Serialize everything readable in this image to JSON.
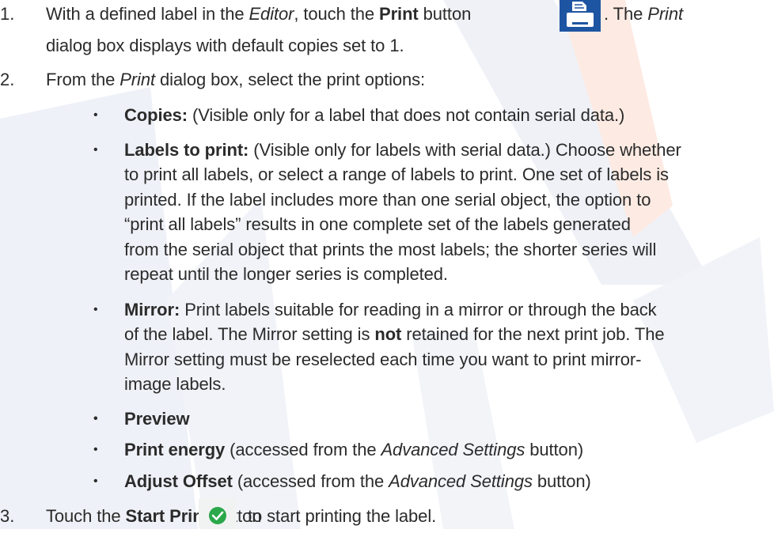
{
  "steps": [
    {
      "number": "1.",
      "lines": [
        {
          "t1": "With a defined label in the ",
          "i1": "Editor",
          "t2": ", touch the ",
          "b1": "Print",
          "t3": " button",
          "t4": ". The ",
          "i2": "Print"
        },
        {
          "t1": "dialog box displays with default copies set to 1."
        }
      ]
    },
    {
      "number": "2.",
      "lines": [
        {
          "t1": "From the ",
          "i1": "Print",
          "t2": " dialog box, select the print options:"
        }
      ]
    },
    {
      "number": "3.",
      "lines": [
        {
          "t1": "Touch the ",
          "b1": "Start Print",
          "t2": " button",
          "t3": " to start printing the label."
        }
      ]
    }
  ],
  "options": [
    {
      "bold": "Copies:",
      "lines": [
        " (Visible only for a label that does not contain serial data.)"
      ]
    },
    {
      "bold": "Labels to print:",
      "lines": [
        " (Visible only for labels with serial data.) Choose whether",
        "to print all labels, or select a range of labels to print. One set of labels is",
        "printed. If the label includes more than one serial object, the option to",
        "“print all labels” results in one complete set of the labels generated",
        "from the serial object that prints the most labels; the shorter series will",
        "repeat until the longer series is completed."
      ]
    },
    {
      "bold": "Mirror:",
      "lines_parts": [
        {
          "t1": " Print labels suitable for reading in a mirror or through the back"
        },
        {
          "t1": "of the label. The Mirror setting is ",
          "b1": "not",
          "t2": " retained for the next print job. The"
        },
        {
          "t1": "Mirror setting must be reselected each time you want to print mirror-"
        },
        {
          "t1": "image labels."
        }
      ]
    },
    {
      "bold": "Preview"
    },
    {
      "bold": "Print energy",
      "t1": " (accessed from the ",
      "i1": "Advanced Settings",
      "t2": " button)"
    },
    {
      "bold": "Adjust Offset",
      "t1": " (accessed from the ",
      "i1": "Advanced Settings",
      "t2": " button)"
    }
  ],
  "bullet_char": "•",
  "icons": {
    "print_button": "printer-icon",
    "start_print_button": "check-circle-icon"
  },
  "colors": {
    "print_button_bg": "#1e55a2",
    "start_print_check": "#2aa84a",
    "watermark": "#e8ecf4",
    "watermark_accent": "#ffd9cc"
  }
}
